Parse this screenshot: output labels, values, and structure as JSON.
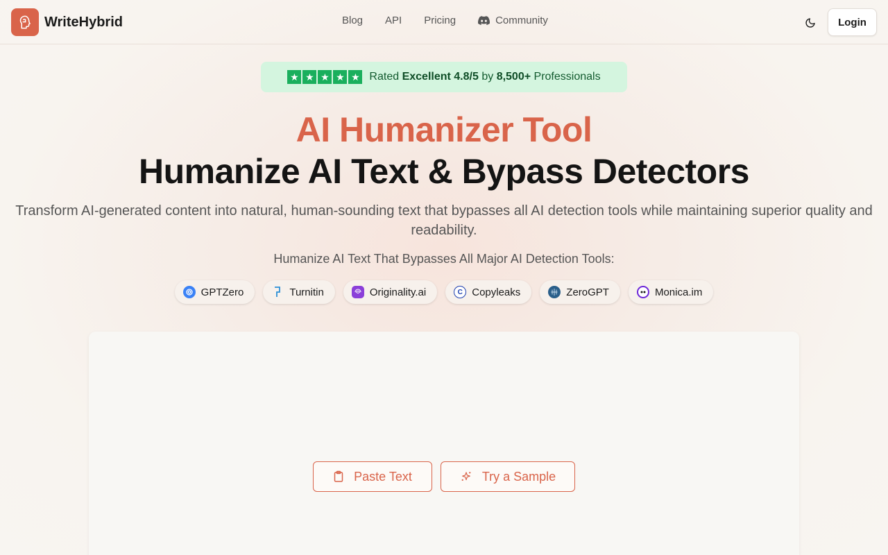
{
  "brand": {
    "name": "WriteHybrid",
    "logo_icon": "brain-icon",
    "accent": "#d9644a"
  },
  "nav": [
    {
      "label": "Blog"
    },
    {
      "label": "API"
    },
    {
      "label": "Pricing"
    },
    {
      "label": "Community",
      "icon": "discord-icon"
    }
  ],
  "header": {
    "theme_toggle_icon": "moon-icon",
    "login_label": "Login"
  },
  "rating": {
    "stars": 5,
    "prefix": "Rated",
    "grade": "Excellent 4.8/5",
    "by": "by",
    "count": "8,500+",
    "suffix": "Professionals",
    "color": "#1aaf5d"
  },
  "hero": {
    "accent_title": "AI Humanizer Tool",
    "title": "Humanize AI Text & Bypass Detectors",
    "subtitle": "Transform AI-generated content into natural, human-sounding text that bypasses all AI detection tools while maintaining superior quality and readability."
  },
  "tools": {
    "title": "Humanize AI Text That Bypasses All Major AI Detection Tools:",
    "items": [
      {
        "label": "GPTZero",
        "icon": "gptzero-icon",
        "color": "#3b82f6"
      },
      {
        "label": "Turnitin",
        "icon": "turnitin-icon",
        "color": "#2b8fd6"
      },
      {
        "label": "Originality.ai",
        "icon": "originality-icon",
        "color": "#8b3fd9"
      },
      {
        "label": "Copyleaks",
        "icon": "copyleaks-icon",
        "color": "#1e40af"
      },
      {
        "label": "ZeroGPT",
        "icon": "zerogpt-icon",
        "color": "#2a5f8a"
      },
      {
        "label": "Monica.im",
        "icon": "monica-icon",
        "color": "#6d28d9"
      }
    ]
  },
  "editor": {
    "paste_label": "Paste Text",
    "paste_icon": "clipboard-icon",
    "sample_label": "Try a Sample",
    "sample_icon": "sparkles-icon"
  }
}
